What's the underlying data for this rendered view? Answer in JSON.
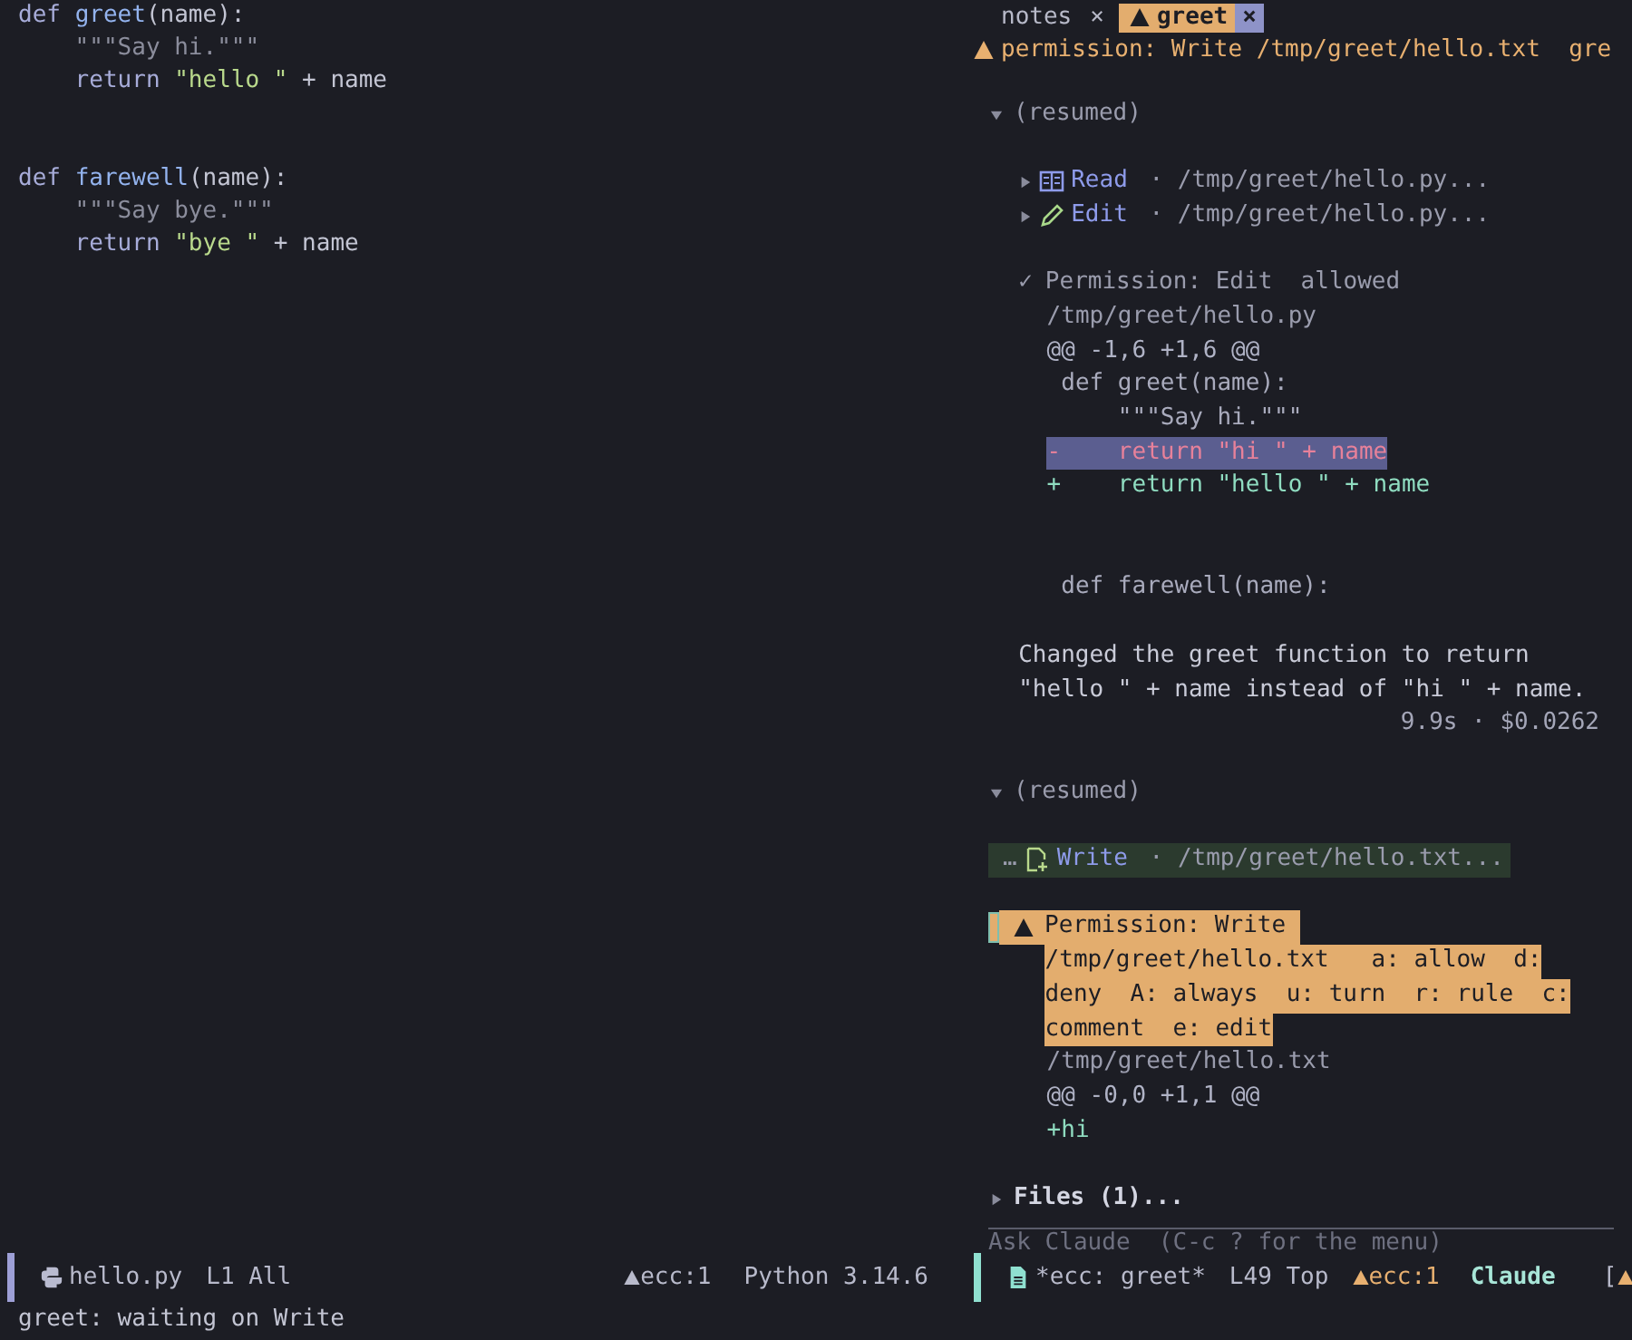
{
  "editor": {
    "lines": [
      {
        "kind": "code",
        "tokens": [
          {
            "t": "def ",
            "kind": "keyword"
          },
          {
            "t": "greet",
            "kind": "function"
          },
          {
            "t": "(name):",
            "kind": "plain"
          }
        ]
      },
      {
        "kind": "code",
        "tokens": [
          {
            "t": "    \"\"\"Say hi.\"\"\"",
            "kind": "doc"
          }
        ]
      },
      {
        "kind": "code",
        "tokens": [
          {
            "t": "    return ",
            "kind": "keyword"
          },
          {
            "t": "\"hello \"",
            "kind": "string"
          },
          {
            "t": " + name",
            "kind": "plain"
          }
        ]
      },
      {
        "kind": "blank"
      },
      {
        "kind": "blank"
      },
      {
        "kind": "code",
        "tokens": [
          {
            "t": "def ",
            "kind": "keyword"
          },
          {
            "t": "farewell",
            "kind": "function"
          },
          {
            "t": "(name):",
            "kind": "plain"
          }
        ]
      },
      {
        "kind": "code",
        "tokens": [
          {
            "t": "    \"\"\"Say bye.\"\"\"",
            "kind": "doc"
          }
        ]
      },
      {
        "kind": "code",
        "tokens": [
          {
            "t": "    return ",
            "kind": "keyword"
          },
          {
            "t": "\"bye \"",
            "kind": "string"
          },
          {
            "t": " + name",
            "kind": "plain"
          }
        ]
      }
    ],
    "mode_line": {
      "file": "hello.py",
      "position": "L1 All",
      "diagnostics": "ecc:1",
      "mode": "Python 3.14.6"
    }
  },
  "chat": {
    "tabs": [
      {
        "label": "notes",
        "selected": false,
        "warning": false,
        "close": "×"
      },
      {
        "label": "greet",
        "selected": true,
        "warning": true,
        "close": "×"
      }
    ],
    "header": "permission: Write /tmp/greet/hello.txt  gre",
    "items": [
      {
        "kind": "blank"
      },
      {
        "kind": "section",
        "expanded": true,
        "bold": false,
        "label": "(resumed)"
      },
      {
        "kind": "blank"
      },
      {
        "kind": "read_tool",
        "expanded": false,
        "highlighted": false,
        "tool": "Read",
        "detail": " · /tmp/greet/hello.py..."
      },
      {
        "kind": "edit_tool",
        "expanded": false,
        "highlighted": false,
        "tool": "Edit",
        "detail": " · /tmp/greet/hello.py..."
      },
      {
        "kind": "blank"
      },
      {
        "kind": "permission_result",
        "mark": "✓",
        "title": "Permission: Edit  allowed"
      },
      {
        "kind": "path",
        "text": "/tmp/greet/hello.py"
      },
      {
        "kind": "hunk",
        "text": "@@ -1,6 +1,6 @@"
      },
      {
        "kind": "context_line",
        "text": " def greet(name):"
      },
      {
        "kind": "context_line",
        "text": "     \"\"\"Say hi.\"\"\""
      },
      {
        "kind": "removed_line",
        "text": "-    return \"hi \" + name"
      },
      {
        "kind": "added_line",
        "text": "+    return \"hello \" + name"
      },
      {
        "kind": "blank"
      },
      {
        "kind": "blank"
      },
      {
        "kind": "context_line",
        "text": " def farewell(name):"
      },
      {
        "kind": "blank"
      },
      {
        "kind": "message",
        "text": "Changed the greet function to return \"hello \" + name instead of \"hi \" + name.",
        "stats": "9.9s · $0.0262"
      },
      {
        "kind": "blank"
      },
      {
        "kind": "section",
        "expanded": true,
        "bold": false,
        "label": "(resumed)"
      },
      {
        "kind": "blank"
      },
      {
        "kind": "write_tool",
        "prefix": "…",
        "highlighted": true,
        "tool": "Write",
        "detail": " · /tmp/greet/hello.txt..."
      },
      {
        "kind": "blank"
      },
      {
        "kind": "permission_request",
        "lines": [
          "Permission: Write ",
          "/tmp/greet/hello.txt   a: allow  d:",
          "deny  A: always  u: turn  r: rule  c:",
          "comment  e: edit"
        ]
      },
      {
        "kind": "path",
        "text": "/tmp/greet/hello.txt"
      },
      {
        "kind": "hunk",
        "text": "@@ -0,0 +1,1 @@"
      },
      {
        "kind": "added_line",
        "text": "+hi"
      },
      {
        "kind": "blank"
      },
      {
        "kind": "section",
        "expanded": false,
        "bold": true,
        "label": "Files (1)..."
      }
    ],
    "prompt": {
      "placeholder": "Ask Claude  (C-c ? for the menu)"
    },
    "mode_line": {
      "buffer": "*ecc: greet*",
      "position": "L49 Top",
      "diagnostics": "ecc:1",
      "mode": "Claude",
      "extra": "["
    }
  },
  "echo_area": "greet: waiting on Write"
}
